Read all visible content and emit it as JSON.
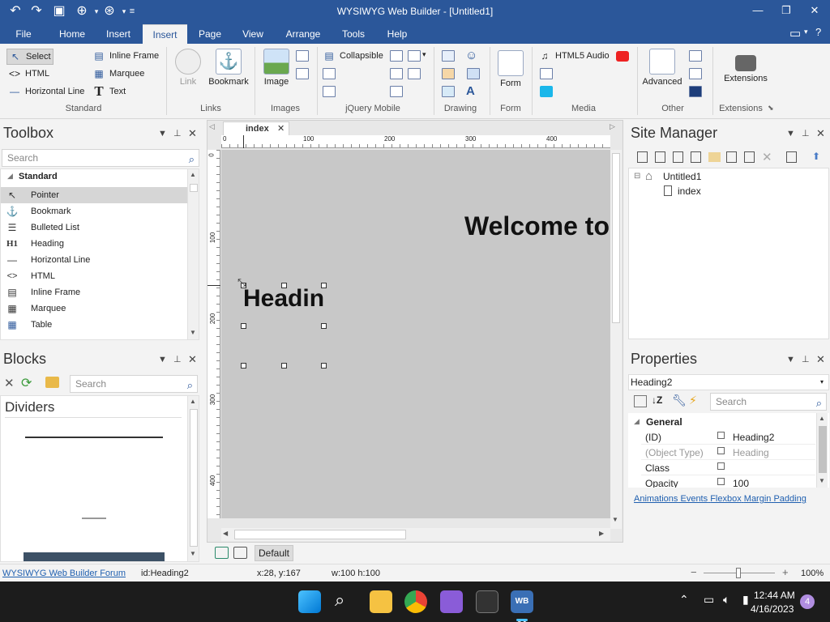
{
  "app": {
    "title": "WYSIWYG Web Builder - [Untitled1]"
  },
  "quick_access": [
    "undo-icon",
    "redo-icon",
    "save-icon",
    "preview-icon",
    "publish-icon",
    "customize-icon"
  ],
  "menu_tabs": [
    {
      "label": "File"
    },
    {
      "label": "Home"
    },
    {
      "label": "Insert"
    },
    {
      "label": "Insert",
      "active": true
    },
    {
      "label": "Page"
    },
    {
      "label": "View"
    },
    {
      "label": "Arrange"
    },
    {
      "label": "Tools"
    },
    {
      "label": "Help"
    }
  ],
  "ribbon": {
    "standard": {
      "select": "Select",
      "html": "HTML",
      "horizontal_line": "Horizontal Line",
      "inline_frame": "Inline Frame",
      "marquee": "Marquee",
      "text": "Text",
      "group": "Standard"
    },
    "links": {
      "link": "Link",
      "bookmark": "Bookmark",
      "group": "Links"
    },
    "images": {
      "image": "Image",
      "group": "Images"
    },
    "jquery": {
      "collapsible": "Collapsible",
      "group": "jQuery Mobile"
    },
    "drawing": {
      "group": "Drawing"
    },
    "form": {
      "form": "Form",
      "group": "Form"
    },
    "media": {
      "html5_audio": "HTML5 Audio",
      "group": "Media"
    },
    "other": {
      "advanced": "Advanced",
      "group": "Other"
    },
    "extensions": {
      "extensions": "Extensions",
      "group": "Extensions"
    }
  },
  "toolbox": {
    "title": "Toolbox",
    "search_placeholder": "Search",
    "category": "Standard",
    "items": [
      {
        "label": "Pointer",
        "icon": "pointer-icon",
        "glyph": "↖"
      },
      {
        "label": "Bookmark",
        "icon": "anchor-icon",
        "glyph": "⚓"
      },
      {
        "label": "Bulleted List",
        "icon": "list-icon",
        "glyph": "☰"
      },
      {
        "label": "Heading",
        "icon": "heading-icon",
        "glyph": "H1"
      },
      {
        "label": "Horizontal Line",
        "icon": "hline-icon",
        "glyph": "—"
      },
      {
        "label": "HTML",
        "icon": "code-icon",
        "glyph": "<>"
      },
      {
        "label": "Inline Frame",
        "icon": "iframe-icon",
        "glyph": "▤"
      },
      {
        "label": "Marquee",
        "icon": "marquee-icon",
        "glyph": "▦"
      },
      {
        "label": "Table",
        "icon": "table-icon",
        "glyph": "▦"
      }
    ]
  },
  "blocks": {
    "title": "Blocks",
    "search_placeholder": "Search",
    "category": "Dividers"
  },
  "editor": {
    "tab": "index",
    "ruler_h": [
      "0",
      "100",
      "200",
      "300",
      "400"
    ],
    "ruler_v": [
      "0",
      "100",
      "200",
      "300",
      "400"
    ],
    "welcome_text": "Welcome to",
    "heading_text": "Headin",
    "layout_label": "Default"
  },
  "site_manager": {
    "title": "Site Manager",
    "root": "Untitled1",
    "page": "index"
  },
  "properties": {
    "title": "Properties",
    "selected": "Heading2",
    "search_placeholder": "Search",
    "section": "General",
    "rows": [
      {
        "name": "(ID)",
        "value": "Heading2",
        "muted": false
      },
      {
        "name": "(Object Type)",
        "value": "Heading",
        "muted": true
      },
      {
        "name": "Class",
        "value": "",
        "muted": false
      },
      {
        "name": "Opacity",
        "value": "100",
        "muted": false
      }
    ],
    "links": [
      "Animations",
      "Events",
      "Flexbox",
      "Margin",
      "Padding"
    ]
  },
  "status": {
    "forum": "WYSIWYG Web Builder Forum",
    "id": "id:Heading2",
    "coords": "x:28, y:167",
    "size": "w:100 h:100",
    "zoom": "100%"
  },
  "taskbar": {
    "time": "12:44 AM",
    "date": "4/16/2023",
    "badge": "4",
    "active_app": "WB 14"
  }
}
